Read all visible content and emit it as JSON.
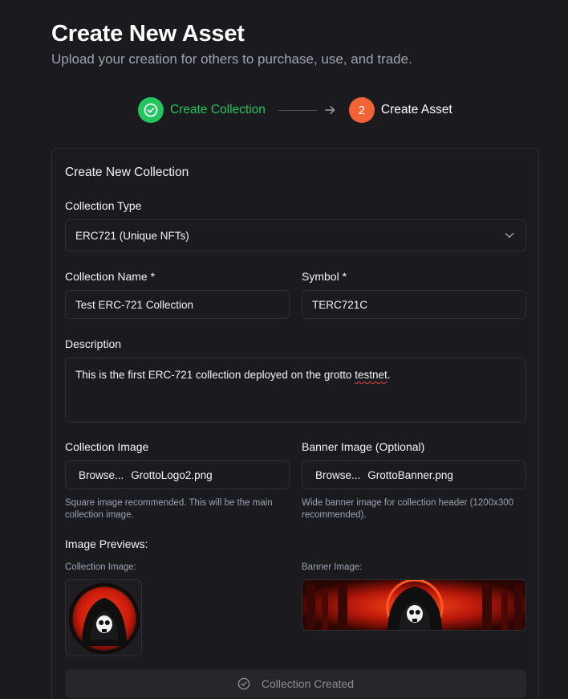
{
  "header": {
    "title": "Create New Asset",
    "subtitle": "Upload your creation for others to purchase, use, and trade."
  },
  "stepper": {
    "step1_label": "Create Collection",
    "step2_number": "2",
    "step2_label": "Create Asset"
  },
  "card": {
    "title": "Create New Collection",
    "collection_type": {
      "label": "Collection Type",
      "selected": "ERC721 (Unique NFTs)"
    },
    "collection_name": {
      "label": "Collection Name *",
      "value": "Test ERC-721 Collection"
    },
    "symbol": {
      "label": "Symbol *",
      "value": "TERC721C"
    },
    "description": {
      "label": "Description",
      "value_before": "This is the first ERC-721 collection deployed on the grotto ",
      "value_misspelled": "testnet",
      "value_after": "."
    },
    "collection_image": {
      "label": "Collection Image",
      "browse": "Browse...",
      "filename": "GrottoLogo2.png",
      "hint": "Square image recommended. This will be the main collection image."
    },
    "banner_image": {
      "label": "Banner Image (Optional)",
      "browse": "Browse...",
      "filename": "GrottoBanner.png",
      "hint": "Wide banner image for collection header (1200x300 recommended)."
    },
    "previews": {
      "label": "Image Previews:",
      "collection_label": "Collection Image:",
      "banner_label": "Banner Image:"
    },
    "submit_label": "Collection Created"
  },
  "colors": {
    "background": "#1b1b1f",
    "success": "#22c55e",
    "accent": "#f26336",
    "muted": "#9ca3af"
  }
}
